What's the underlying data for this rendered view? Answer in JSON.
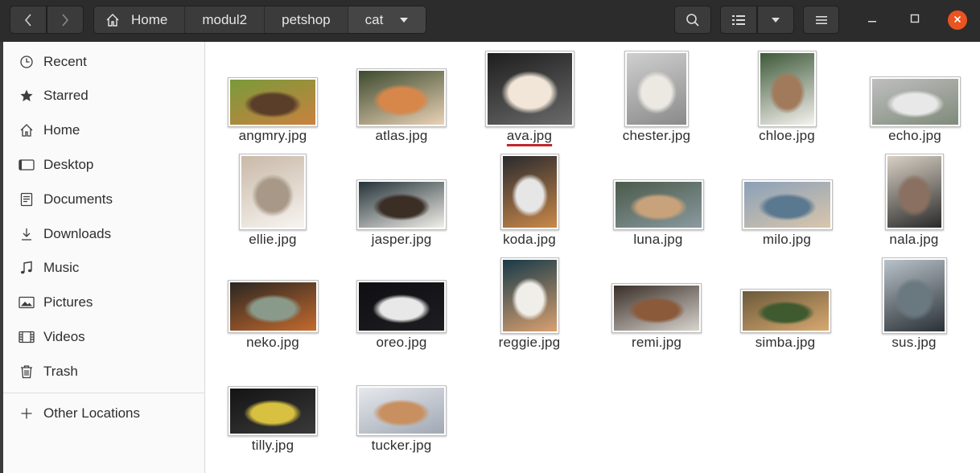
{
  "headerbar": {
    "back_icon": "chevron-left-icon",
    "forward_icon": "chevron-right-icon",
    "search_icon": "search-icon",
    "view_icon": "list-view-icon",
    "view_menu_icon": "chevron-down-icon",
    "menu_icon": "hamburger-icon",
    "close_color": "#e95420"
  },
  "pathbar": [
    "Home",
    "modul2",
    "petshop",
    "cat"
  ],
  "sidebar": {
    "items": [
      {
        "label": "Recent",
        "icon": "clock-icon"
      },
      {
        "label": "Starred",
        "icon": "star-icon"
      },
      {
        "label": "Home",
        "icon": "home-icon"
      },
      {
        "label": "Desktop",
        "icon": "desktop-icon"
      },
      {
        "label": "Documents",
        "icon": "document-icon"
      },
      {
        "label": "Downloads",
        "icon": "download-icon"
      },
      {
        "label": "Music",
        "icon": "music-icon"
      },
      {
        "label": "Pictures",
        "icon": "pictures-icon"
      },
      {
        "label": "Videos",
        "icon": "video-icon"
      },
      {
        "label": "Trash",
        "icon": "trash-icon"
      }
    ],
    "other": {
      "label": "Other Locations",
      "icon": "plus-icon"
    }
  },
  "files": [
    {
      "name": "angmry.jpg",
      "colors": [
        "#7a9a3a",
        "#c9813f",
        "#5a3e2a"
      ]
    },
    {
      "name": "atlas.jpg",
      "colors": [
        "#3d4a2e",
        "#e9d2b6",
        "#d8874a"
      ]
    },
    {
      "name": "ava.jpg",
      "colors": [
        "#1e1e1e",
        "#6a6a6a",
        "#f2e6d8"
      ],
      "selected": true
    },
    {
      "name": "chester.jpg",
      "colors": [
        "#cfcfcf",
        "#8a8a8a",
        "#ece9e3"
      ]
    },
    {
      "name": "chloe.jpg",
      "colors": [
        "#3e5a3a",
        "#f5f2ee",
        "#a07a5a"
      ]
    },
    {
      "name": "echo.jpg",
      "colors": [
        "#bfbfbf",
        "#7f8a7a",
        "#e8e8e8"
      ]
    },
    {
      "name": "ellie.jpg",
      "colors": [
        "#c9b9a8",
        "#f7f4f0",
        "#a89888"
      ]
    },
    {
      "name": "jasper.jpg",
      "colors": [
        "#243238",
        "#f1efe9",
        "#3b2e25"
      ]
    },
    {
      "name": "koda.jpg",
      "colors": [
        "#2a2a2e",
        "#c9884a",
        "#e6e6e6"
      ]
    },
    {
      "name": "luna.jpg",
      "colors": [
        "#4a5a4a",
        "#8a9aa0",
        "#c7a27a"
      ]
    },
    {
      "name": "milo.jpg",
      "colors": [
        "#8aa0b8",
        "#d9c6ac",
        "#5a7890"
      ]
    },
    {
      "name": "nala.jpg",
      "colors": [
        "#d8d0c4",
        "#2a2a2a",
        "#8a7060"
      ]
    },
    {
      "name": "neko.jpg",
      "colors": [
        "#2a2622",
        "#c46a2e",
        "#8a9a8a"
      ]
    },
    {
      "name": "oreo.jpg",
      "colors": [
        "#0f0f12",
        "#1e1e22",
        "#e8e8e8"
      ]
    },
    {
      "name": "reggie.jpg",
      "colors": [
        "#183a48",
        "#d8a070",
        "#f0eee8"
      ]
    },
    {
      "name": "remi.jpg",
      "colors": [
        "#3a2e28",
        "#d8d4ce",
        "#8a5a3a"
      ]
    },
    {
      "name": "simba.jpg",
      "colors": [
        "#6a5a3a",
        "#d8a870",
        "#3e5a2e"
      ]
    },
    {
      "name": "sus.jpg",
      "colors": [
        "#b8c2c8",
        "#2a3036",
        "#6a7880"
      ]
    },
    {
      "name": "tilly.jpg",
      "colors": [
        "#141414",
        "#3a3a3a",
        "#d8c040"
      ]
    },
    {
      "name": "tucker.jpg",
      "colors": [
        "#e6e8ec",
        "#a0a8b4",
        "#c89060"
      ]
    }
  ]
}
